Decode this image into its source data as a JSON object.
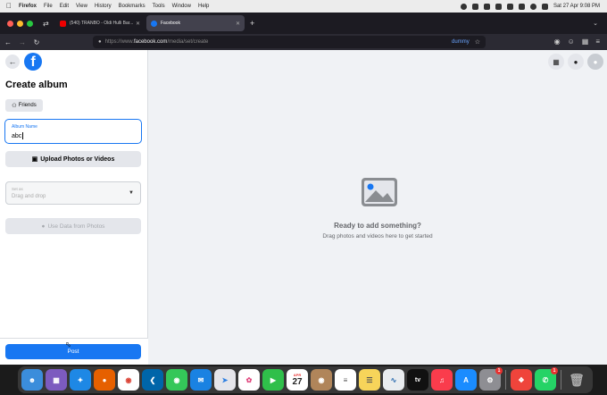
{
  "menubar": {
    "items": [
      "Firefox",
      "File",
      "Edit",
      "View",
      "History",
      "Bookmarks",
      "Tools",
      "Window",
      "Help"
    ],
    "datetime": "Sat 27 Apr 9:08 PM"
  },
  "tabs": [
    {
      "label": "(540) TRANBO - Oldi Hulli Bar... YouTube",
      "icon": "youtube-icon"
    },
    {
      "label": "Facebook",
      "icon": "facebook-icon"
    }
  ],
  "addressbar": {
    "url_prefix": "https://www.",
    "url_domain": "facebook.com",
    "url_path": "/media/set/create",
    "profile_label": "dummy"
  },
  "sidebar": {
    "title": "Create album",
    "audience_label": "Friends",
    "album_name_label": "Album Name",
    "album_name_value": "abc",
    "upload_label": "Upload Photos or Videos",
    "select_label": "Set as",
    "select_value": "Drag and drop",
    "use_data_label": "Use Data from Photos",
    "post_label": "Post"
  },
  "main": {
    "ready_title": "Ready to add something?",
    "ready_sub": "Drag photos and videos here to get started"
  },
  "dock": {
    "calendar_month": "APR",
    "calendar_day": "27",
    "tv_label": "tv",
    "badges": {
      "settings": "1",
      "anydesk": "1"
    }
  },
  "colors": {
    "fb_blue": "#1877f2",
    "page_bg": "#f0f2f5"
  }
}
